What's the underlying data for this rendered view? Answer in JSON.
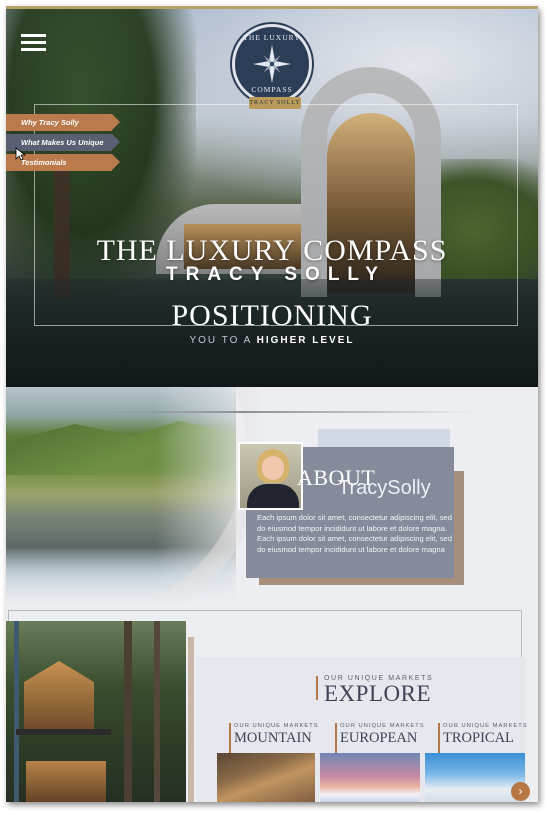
{
  "nav": {
    "menu_icon": "hamburger-menu-icon",
    "side_menu": [
      {
        "label": "Why Tracy Solly"
      },
      {
        "label": "What Makes Us Unique"
      },
      {
        "label": "Testimonials"
      }
    ]
  },
  "logo": {
    "ring_top": "THE LUXURY",
    "ring_bottom": "COMPASS",
    "tag": "TRACY SOLLY",
    "icon": "compass-star-icon"
  },
  "hero": {
    "title": "THE LUXURY COMPASS",
    "name": "TRACY SOLLY",
    "heading": "POSITIONING",
    "tag_light": "YOU TO A",
    "tag_strong": "HIGHER LEVEL"
  },
  "about": {
    "title": "ABOUT",
    "name": "TracySolly",
    "body": "Each ipsum dolor sit amet, consectetur adipiscing elit, sed do eiusmod tempor incididunt ut labore et dolore magna. Each ipsum dolor sit amet, consectetur adipiscing elit, sed do eiusmod tempor incididunt ut labore et dolore magna"
  },
  "markets": {
    "kicker": "OUR UNIQUE MARKETS",
    "title": "EXPLORE",
    "items": [
      {
        "kicker": "OUR UNIQUE MARKETS",
        "title": "MOUNTAIN"
      },
      {
        "kicker": "OUR UNIQUE MARKETS",
        "title": "EUROPEAN"
      },
      {
        "kicker": "OUR UNIQUE MARKETS",
        "title": "TROPICAL"
      }
    ],
    "next_icon": "chevron-right-icon"
  },
  "colors": {
    "accent_copper": "#bb7a4b",
    "slate": "#5a5f72",
    "navy": "#2c3e57",
    "gold": "#b99a58"
  }
}
